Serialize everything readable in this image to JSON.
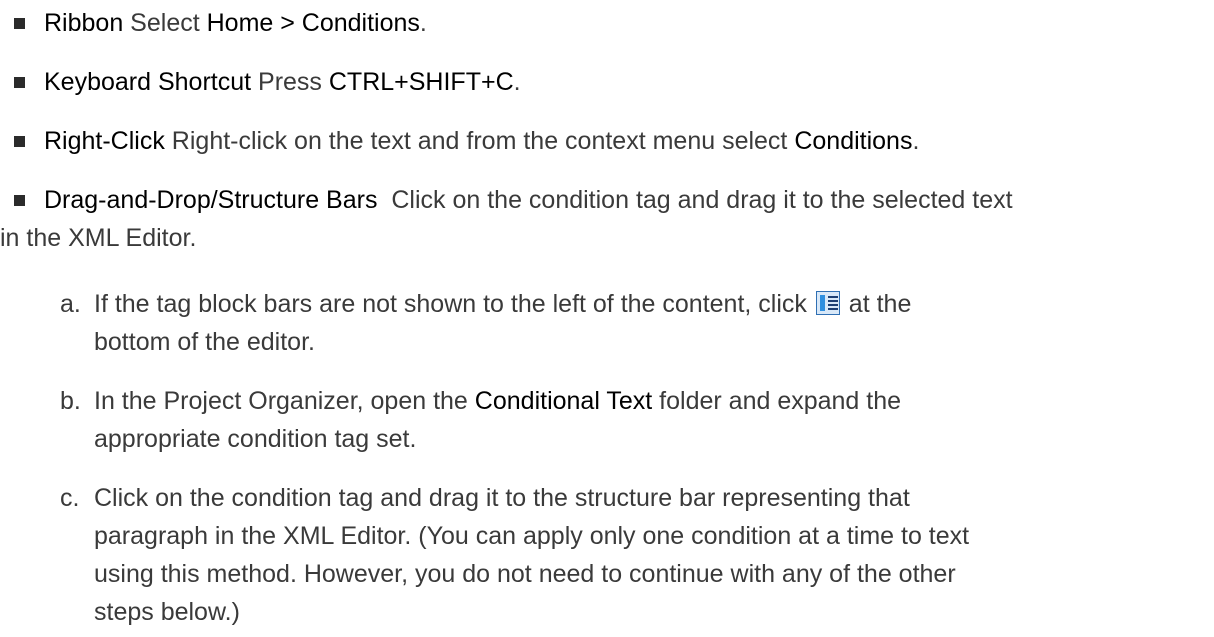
{
  "bullets": [
    {
      "label": "Ribbon",
      "text_before": " Select ",
      "strong2": "Home > Conditions",
      "text_after": "."
    },
    {
      "label": "Keyboard Shortcut",
      "text_before": " Press ",
      "strong2": "CTRL+SHIFT+C",
      "text_after": "."
    },
    {
      "label": "Right-Click",
      "text_before": " Right-click on the text and from the context menu select ",
      "strong2": "Conditions",
      "text_after": "."
    },
    {
      "label": "Drag-and-Drop/Structure Bars",
      "line1": "  Click on the condition tag and drag it to the selected text",
      "line2": "in the XML Editor."
    }
  ],
  "substeps": [
    {
      "letter": "a.",
      "line1_before": "If the tag block bars are not shown to the left of the content, click ",
      "icon": "show-tag-bars-icon",
      "line1_after": " at the",
      "line2": "bottom of the editor."
    },
    {
      "letter": "b.",
      "line1_before": "In the Project Organizer, open the ",
      "strong": "Conditional Text",
      "line1_after": " folder and expand the",
      "line2": "appropriate condition tag set."
    },
    {
      "letter": "c.",
      "line1": "Click on the condition tag and drag it to the structure bar representing that",
      "line2": "paragraph in the XML Editor. (You can apply only one condition at a time to text",
      "line3": "using this method. However, you do not need to continue with any of the other",
      "line4": "steps below.)"
    }
  ]
}
